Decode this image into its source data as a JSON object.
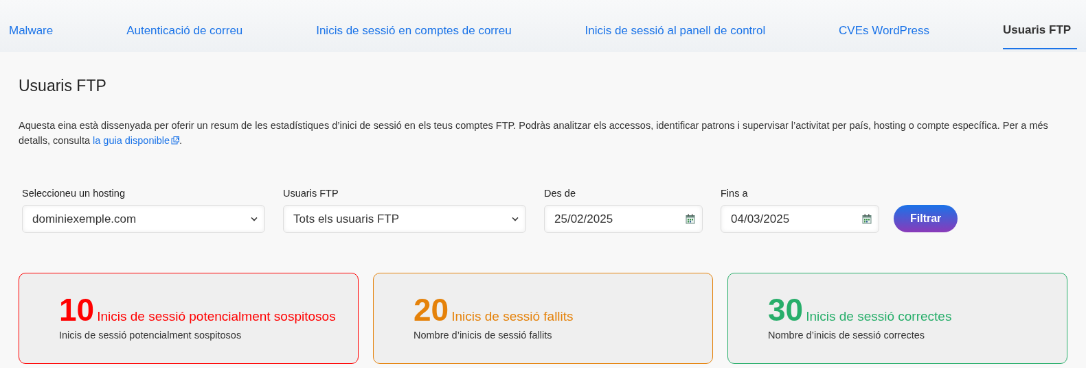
{
  "tabs": [
    {
      "label": "Malware",
      "selected": false
    },
    {
      "label": "Autenticació de correu",
      "selected": false
    },
    {
      "label": "Inicis de sessió en comptes de correu",
      "selected": false
    },
    {
      "label": "Inicis de sessió al panell de control",
      "selected": false
    },
    {
      "label": "CVEs WordPress",
      "selected": false
    },
    {
      "label": "Usuaris FTP",
      "selected": true
    }
  ],
  "title": "Usuaris FTP",
  "description": {
    "text": "Aquesta eina està dissenyada per oferir un resum de les estadístiques d’inici de sessió en els teus comptes FTP. Podràs analitzar els accessos, identificar patrons i supervisar l’activitat per país, hosting o compte específica. Per a més detalls, consulta ",
    "link": "la guia disponible",
    "end": "."
  },
  "filters": [
    {
      "kind": "select",
      "label": "Seleccioneu un hosting",
      "value": "dominiexemple.com"
    },
    {
      "kind": "select",
      "label": "Usuaris FTP",
      "value": "Tots els usuaris FTP"
    },
    {
      "kind": "date",
      "label": "Des de",
      "value": "25/02/2025"
    },
    {
      "kind": "date",
      "label": "Fins a",
      "value": "04/03/2025"
    }
  ],
  "filter_button": "Filtrar",
  "cards": [
    {
      "count": "10",
      "title": "Inicis de sessió potencialment sospitosos",
      "caption": "Inicis de sessió potencialment sospitosos",
      "color": "#ff0000"
    },
    {
      "count": "20",
      "title": "Inicis de sessió fallits",
      "caption": "Nombre d’inicis de sessió fallits",
      "color": "#e5820a"
    },
    {
      "count": "30",
      "title": "Inicis de sessió correctes",
      "caption": "Nombre d’inicis de sessió correctes",
      "color": "#27ae6a"
    }
  ]
}
